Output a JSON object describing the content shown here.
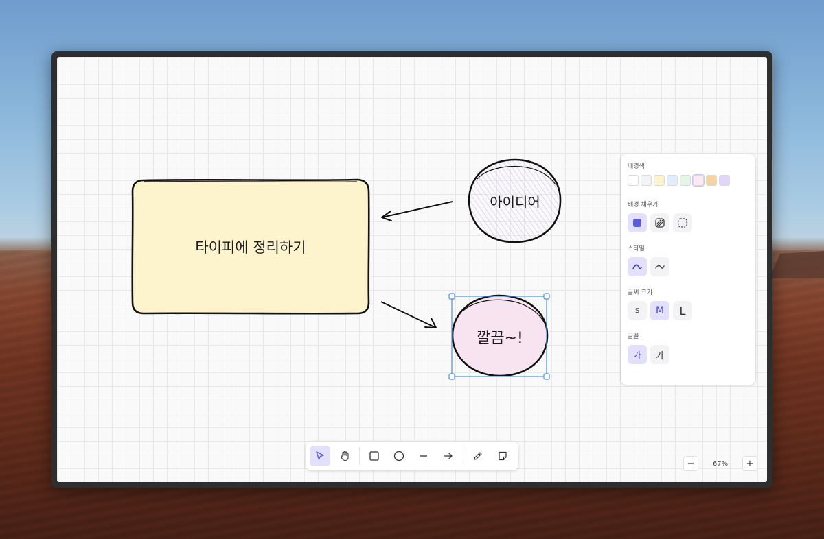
{
  "canvas": {
    "shapes": [
      {
        "id": "rect",
        "label": "타이피에 정리하기",
        "fill": "#fdf4cd"
      },
      {
        "id": "idea",
        "label": "아이디어",
        "fill": "#efe4f9"
      },
      {
        "id": "neat",
        "label": "깔끔~!",
        "fill": "#f8e3f1"
      }
    ]
  },
  "panel": {
    "background_color": {
      "title": "배경색",
      "swatches": [
        "#ffffff",
        "#f1f3f5",
        "#fdf4cd",
        "#e3ecfb",
        "#e4f6e6",
        "#fde8f3",
        "#f6d3a3",
        "#e1d5fa"
      ],
      "selected_index": 5
    },
    "fill": {
      "title": "배경 채우기",
      "options": [
        "solid",
        "hatch",
        "none"
      ],
      "selected": "solid"
    },
    "style": {
      "title": "스타일",
      "options": [
        "sketchy",
        "smooth"
      ],
      "selected": "sketchy"
    },
    "font_size": {
      "title": "글씨 크기",
      "options": [
        "S",
        "M",
        "L"
      ],
      "selected": "M"
    },
    "font": {
      "title": "글꼴",
      "options": [
        "가",
        "가"
      ],
      "selected_index": 0
    }
  },
  "toolbar": {
    "tools": [
      "select",
      "hand",
      "rectangle",
      "ellipse",
      "line",
      "arrow",
      "pencil",
      "note"
    ],
    "selected": "select"
  },
  "zoom": {
    "minus": "−",
    "level": "67%",
    "plus": "+"
  },
  "colors": {
    "accent": "#5b5bd6",
    "selection": "#4a8ff0"
  }
}
